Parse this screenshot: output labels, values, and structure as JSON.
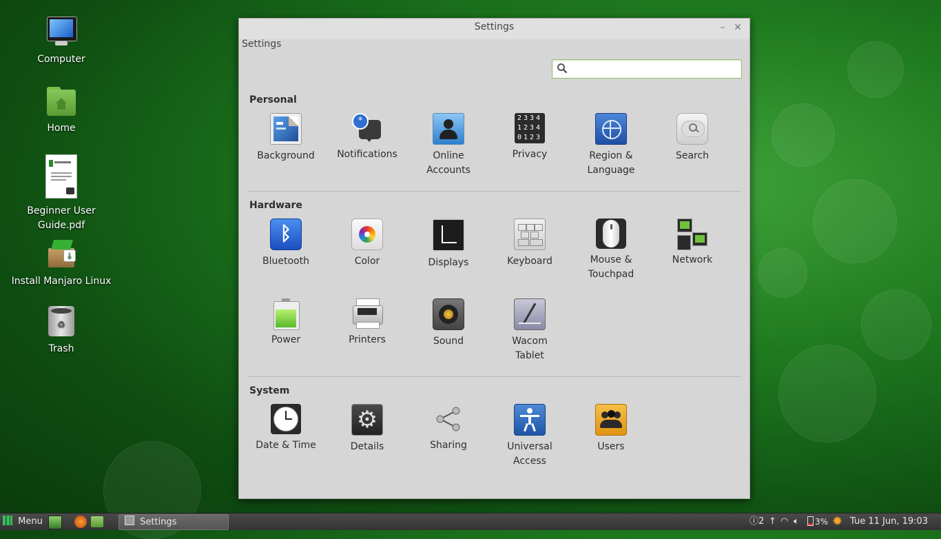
{
  "desktop": {
    "icons": [
      {
        "label": "Computer"
      },
      {
        "label": "Home"
      },
      {
        "label": "Beginner User\nGuide.pdf"
      },
      {
        "label": "Install Manjaro Linux"
      },
      {
        "label": "Trash"
      }
    ]
  },
  "window": {
    "title": "Settings",
    "breadcrumb": "Settings",
    "search": {
      "value": "",
      "placeholder": ""
    },
    "sections": [
      {
        "title": "Personal",
        "items": [
          {
            "label": "Background",
            "icon": "background-icon"
          },
          {
            "label": "Notifications",
            "icon": "notifications-icon"
          },
          {
            "label": "Online Accounts",
            "icon": "online-accounts-icon"
          },
          {
            "label": "Privacy",
            "icon": "privacy-icon"
          },
          {
            "label": "Region & Language",
            "icon": "region-language-icon"
          },
          {
            "label": "Search",
            "icon": "search-icon"
          }
        ]
      },
      {
        "title": "Hardware",
        "items": [
          {
            "label": "Bluetooth",
            "icon": "bluetooth-icon"
          },
          {
            "label": "Color",
            "icon": "color-icon"
          },
          {
            "label": "Displays",
            "icon": "displays-icon"
          },
          {
            "label": "Keyboard",
            "icon": "keyboard-icon"
          },
          {
            "label": "Mouse & Touchpad",
            "icon": "mouse-icon"
          },
          {
            "label": "Network",
            "icon": "network-icon"
          },
          {
            "label": "Power",
            "icon": "power-icon"
          },
          {
            "label": "Printers",
            "icon": "printer-icon"
          },
          {
            "label": "Sound",
            "icon": "sound-icon"
          },
          {
            "label": "Wacom Tablet",
            "icon": "wacom-tablet-icon"
          }
        ]
      },
      {
        "title": "System",
        "items": [
          {
            "label": "Date & Time",
            "icon": "clock-icon"
          },
          {
            "label": "Details",
            "icon": "details-gear-icon"
          },
          {
            "label": "Sharing",
            "icon": "sharing-icon"
          },
          {
            "label": "Universal Access",
            "icon": "universal-access-icon"
          },
          {
            "label": "Users",
            "icon": "users-icon"
          }
        ]
      }
    ]
  },
  "taskbar": {
    "menu_label": "Menu",
    "task_label": "Settings",
    "notification_count": "2",
    "battery_percent": "3%",
    "clock": "Tue 11 Jun, 19:03"
  },
  "colors": {
    "accent_green": "#8fc06a",
    "window_bg": "#d6d6d6",
    "taskbar_bg": "#3a3a3a"
  }
}
